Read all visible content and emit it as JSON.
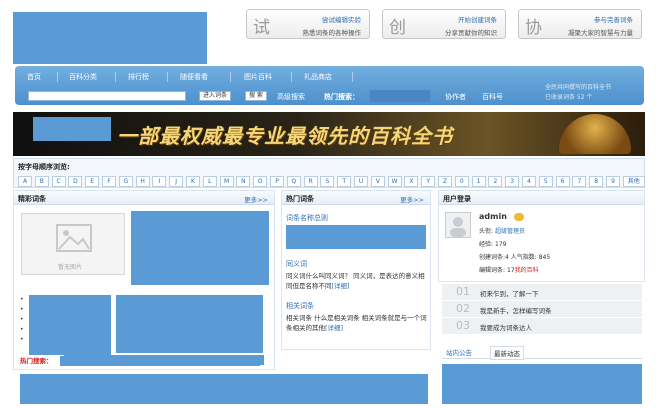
{
  "features": [
    {
      "char": "试",
      "title": "尝试编辑实验",
      "subtitle": "熟悉词条的各种操作"
    },
    {
      "char": "创",
      "title": "开始创建词条",
      "subtitle": "分享贡献你的知识"
    },
    {
      "char": "协",
      "title": "参与完善词条",
      "subtitle": "凝聚大家的智慧与力量"
    }
  ],
  "nav": {
    "items": [
      "首页",
      "百科分类",
      "排行榜",
      "随便看看",
      "图片百科",
      "礼品商店"
    ],
    "stats_line1": "全民共同撰写的百科全书",
    "stats_line2": "已收录词条 52 个",
    "search_placeholder": "",
    "search_entry_button": "进入词条",
    "search_button": "搜 索",
    "advanced_search": "高级搜索",
    "hot_search_label": "热门搜索：",
    "collaborators": "协作者",
    "baike_link": "百科号"
  },
  "banner": {
    "slogan": "一部最权威最专业最领先的百科全书"
  },
  "browse": {
    "label": "按字母顺序浏览:",
    "letters": [
      "A",
      "B",
      "C",
      "D",
      "E",
      "F",
      "G",
      "H",
      "I",
      "J",
      "K",
      "L",
      "M",
      "N",
      "O",
      "P",
      "Q",
      "R",
      "S",
      "T",
      "U",
      "V",
      "W",
      "X",
      "Y",
      "Z",
      "0",
      "1",
      "2",
      "3",
      "4",
      "5",
      "6",
      "7",
      "8",
      "9",
      "其他"
    ]
  },
  "featured": {
    "title": "精彩词条",
    "more": "更多>>",
    "no_image": "暂无图片",
    "hot_search_label": "热门搜索："
  },
  "hot_entries": {
    "title": "热门词条",
    "more": "更多>>",
    "items": [
      {
        "title": "词条名称总则",
        "desc": ""
      },
      {
        "title": "同义词",
        "desc": "同义词什么叫同义词？ 同义词，是表达的意义相同但是名称不同",
        "detail": "[详细]"
      },
      {
        "title": "相关词条",
        "desc": "相关词条 什么是相关词条 相关词条就是与一个词条相关的其他",
        "detail": "[详细]"
      }
    ]
  },
  "user": {
    "title": "用户登录",
    "name": "admin",
    "rank_label": "头衔:",
    "rank_value": "超级管理员",
    "exp_label": "经验:",
    "exp_value": "179",
    "created_label": "创建词条:",
    "created_value": "4",
    "popularity_label": "人气指数:",
    "popularity_value": "845",
    "edited_label": "编辑词条:",
    "edited_value": "17",
    "my_baike": "我的百科"
  },
  "tasks": [
    {
      "num": "01",
      "text": "初来乍到，了解一下"
    },
    {
      "num": "02",
      "text": "我是新手，怎样编写词条"
    },
    {
      "num": "03",
      "text": "我要成为词条达人"
    }
  ],
  "tabs": [
    "站内公告",
    "最新动态"
  ]
}
